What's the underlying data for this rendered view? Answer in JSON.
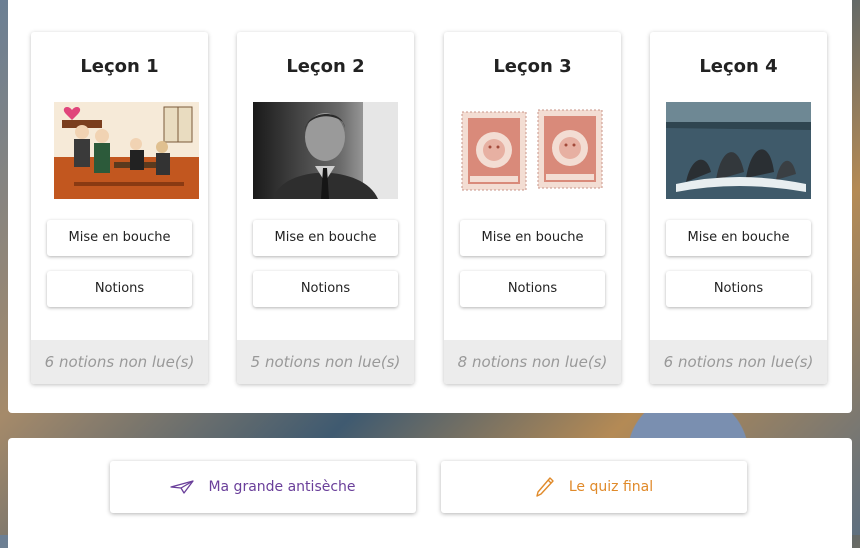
{
  "lessons": [
    {
      "title": "Leçon 1",
      "button1": "Mise en bouche",
      "button2": "Notions",
      "footer": "6 notions non lue(s)",
      "image": "cartoon-salon-scene"
    },
    {
      "title": "Leçon 2",
      "button1": "Mise en bouche",
      "button2": "Notions",
      "footer": "5 notions non lue(s)",
      "image": "black-and-white-portrait"
    },
    {
      "title": "Leçon 3",
      "button1": "Mise en bouche",
      "button2": "Notions",
      "footer": "8 notions non lue(s)",
      "image": "montevideo-stamps"
    },
    {
      "title": "Leçon 4",
      "button1": "Mise en bouche",
      "button2": "Notions",
      "footer": "6 notions non lue(s)",
      "image": "humpback-whales"
    }
  ],
  "actions": {
    "cheatsheet": {
      "label": "Ma grande antisèche",
      "icon": "paper-plane-icon",
      "color": "#6a3f9a"
    },
    "quiz": {
      "label": "Le quiz final",
      "icon": "pencil-icon",
      "color": "#e08a2a"
    }
  }
}
